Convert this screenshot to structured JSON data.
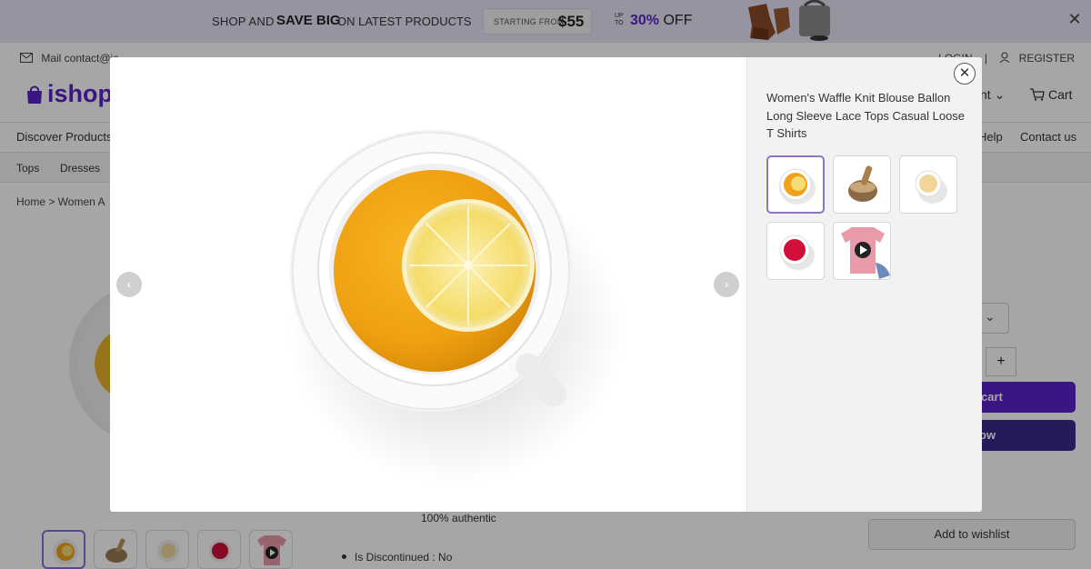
{
  "promo": {
    "text_prefix": "SHOP AND",
    "text_bold": "SAVE BIG",
    "text_suffix": "ON LATEST PRODUCTS",
    "starting_label": "STARTING FROM",
    "starting_price": "$55",
    "upto": "UP TO",
    "discount": "30%",
    "off": "OFF",
    "close_icon": "close-icon"
  },
  "util": {
    "mail": "Mail contact@ic...",
    "login": "LOGIN",
    "register": "REGISTER"
  },
  "header": {
    "logo": "ishop",
    "account_fragment": "nt",
    "cart": "Cart"
  },
  "nav": {
    "discover": "Discover Products",
    "help": "Help",
    "contact": "Contact us"
  },
  "subnav": {
    "tops": "Tops",
    "dresses": "Dresses"
  },
  "breadcrumb": "Home  >  Women A",
  "page": {
    "authentic": "100% authentic",
    "discontinued": "Is Discontinued  :  No",
    "add_to_cart_fragment": "cart",
    "buy_now_fragment": "ow",
    "quantity_plus": "+",
    "wishlist": "Add to wishlist"
  },
  "modal": {
    "title": "Women's Waffle Knit Blouse Ballon Long Sleeve Lace Tops Casual Loose T Shirts",
    "close_icon": "close-icon",
    "prev_icon": "chevron-left-icon",
    "next_icon": "chevron-right-icon",
    "thumbs": [
      {
        "name": "tea-lemon",
        "selected": true
      },
      {
        "name": "mortar-pestle",
        "selected": false
      },
      {
        "name": "tea-milk",
        "selected": false
      },
      {
        "name": "tea-red",
        "selected": false
      },
      {
        "name": "tshirt-video",
        "selected": false
      }
    ]
  },
  "colors": {
    "brand": "#5a22c8",
    "tea": "#f0a21a",
    "lemon": "#f6dc74"
  }
}
